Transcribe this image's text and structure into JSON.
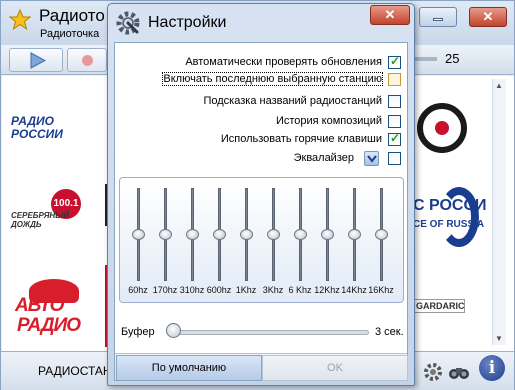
{
  "main": {
    "title": "Радиото",
    "subtitle": "Радиоточка",
    "volume_value": "25",
    "bottom_label": "РАДИОСТАН",
    "stations": {
      "radio_rossii": [
        "РАДИО",
        "РОССИИ"
      ],
      "serebryany": {
        "number": "100.1",
        "name": "СЕРЕБРЯНЫЙ ДОЖДЬ"
      },
      "avtoradio": [
        "АВТО",
        "РАДИО"
      ],
      "voice": [
        "С РОССИ",
        "CE OF RUSSIA"
      ],
      "gardarica": "GARDARICA"
    }
  },
  "dialog": {
    "title": "Настройки",
    "options": [
      {
        "label": "Автоматически проверять обновления",
        "checked": true
      },
      {
        "label": "Включать последнюю выбранную станцию",
        "checked": false
      },
      {
        "label": "Подсказка названий радиостанций",
        "checked": false
      },
      {
        "label": "История композиций",
        "checked": false
      },
      {
        "label": "Использовать горячие клавиши",
        "checked": true
      },
      {
        "label": "Эквалайзер",
        "checked": false
      }
    ],
    "check_mark": "✓",
    "equalizer": {
      "bands": [
        "60hz",
        "170hz",
        "310hz",
        "600hz",
        "1Khz",
        "3Khz",
        "6 Khz",
        "12Khz",
        "14Khz",
        "16Khz"
      ],
      "levels": [
        0,
        0,
        0,
        0,
        0,
        0,
        0,
        0,
        0,
        0
      ]
    },
    "buffer": {
      "label": "Буфер",
      "value": "3 сек.",
      "level": 0
    },
    "buttons": {
      "default": "По умолчанию",
      "ok": "OK"
    }
  }
}
